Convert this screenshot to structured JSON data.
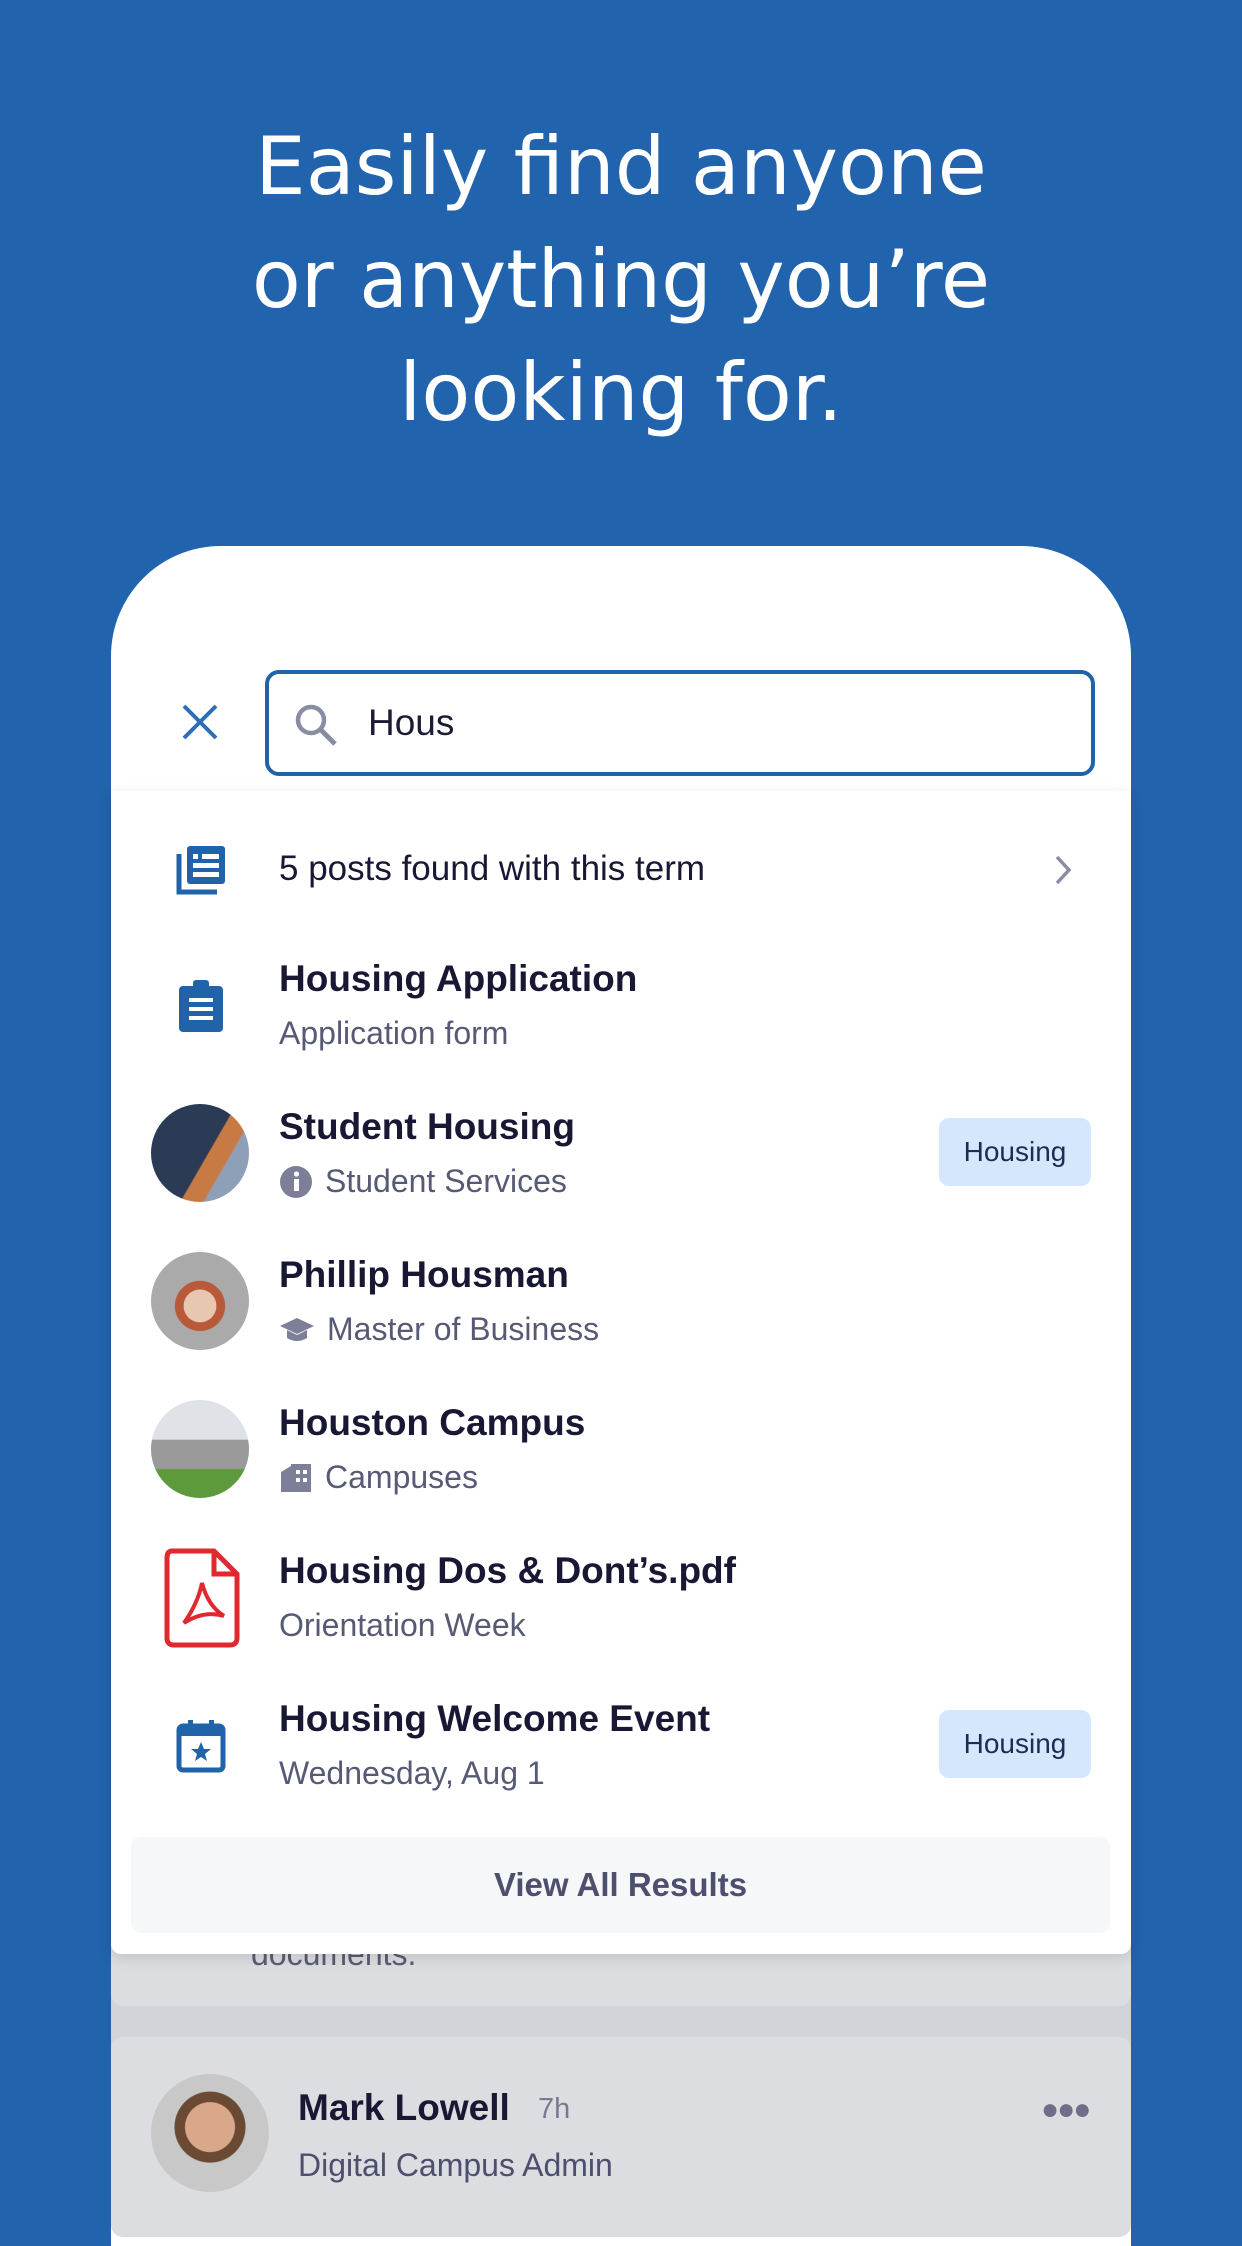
{
  "headline": {
    "line1": "Easily find anyone",
    "line2": "or anything you’re",
    "line3": "looking for."
  },
  "search": {
    "value": "Hous",
    "close_icon": "close-icon",
    "search_icon": "search-icon"
  },
  "colors": {
    "background": "#2163ad",
    "accent": "#2163a8",
    "badge": "#d4e7fd"
  },
  "results": {
    "posts": {
      "label": "5 posts found with this term",
      "icon": "newspaper-icon"
    },
    "items": [
      {
        "title": "Housing Application",
        "subtitle": "Application form",
        "icon": "clipboard-icon"
      },
      {
        "title": "Student Housing",
        "subtitle": "Student Services",
        "subicon": "info-icon",
        "badge": "Housing",
        "avatar": "building-photo"
      },
      {
        "title": "Phillip Housman",
        "subtitle": "Master of Business",
        "subicon": "graduation-cap-icon",
        "avatar": "person-photo"
      },
      {
        "title": "Houston Campus",
        "subtitle": "Campuses",
        "subicon": "building-icon",
        "avatar": "campus-photo"
      },
      {
        "title": "Housing Dos & Dont’s.pdf",
        "subtitle": "Orientation Week",
        "icon": "pdf-icon"
      },
      {
        "title": "Housing Welcome Event",
        "subtitle": "Wednesday, Aug 1",
        "icon": "calendar-icon",
        "badge": "Housing"
      }
    ],
    "view_all": "View All Results"
  },
  "feed": {
    "partial_text": "documents.",
    "post": {
      "author": "Mark Lowell",
      "time": "7h",
      "role": "Digital Campus Admin"
    }
  }
}
